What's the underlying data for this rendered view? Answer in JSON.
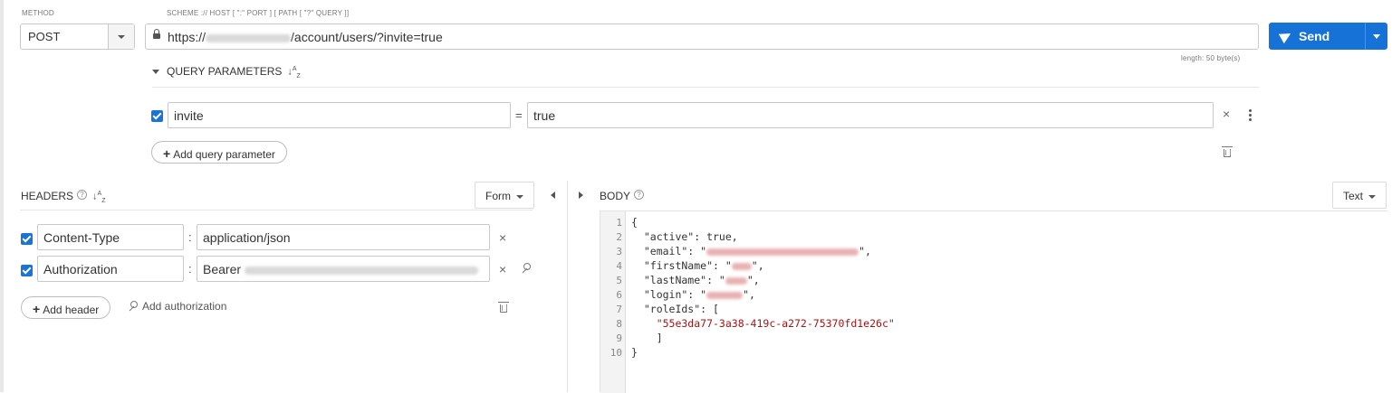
{
  "request": {
    "method_label": "METHOD",
    "method": "POST",
    "url_hint": "SCHEME :// HOST [ \":\" PORT ] [ PATH [ \"?\" QUERY ]]",
    "url_prefix": "https://",
    "url_suffix": "/account/users/?invite=true",
    "length_text": "length: 50 byte(s)",
    "send_label": "Send"
  },
  "query": {
    "title": "QUERY PARAMETERS",
    "params": [
      {
        "name": "invite",
        "value": "true",
        "enabled": true
      }
    ],
    "add_label": "Add query parameter"
  },
  "headers": {
    "title": "HEADERS",
    "mode": "Form",
    "items": [
      {
        "name": "Content-Type",
        "value": "application/json",
        "enabled": true
      },
      {
        "name": "Authorization",
        "value": "Bearer ",
        "enabled": true
      }
    ],
    "add_label": "Add header",
    "auth_label": "Add authorization"
  },
  "body": {
    "title": "BODY",
    "mode": "Text",
    "line_numbers": [
      "1",
      "2",
      "3",
      "4",
      "5",
      "6",
      "7",
      "8",
      "9",
      "10"
    ],
    "lines": [
      "{",
      "  \"active\": true,",
      "  \"email\": \"",
      "  \"firstName\": \"",
      "  \"lastName\": \"",
      "  \"login\": \"",
      "  \"roleIds\": [",
      "    \"55e3da77-3a38-419c-a272-75370fd1e26c\"",
      "    ]",
      "}"
    ]
  },
  "colors": {
    "accent": "#1672d6",
    "checkbox": "#1a73d8",
    "json_key": "#8b0000",
    "json_string": "#a31515",
    "json_bool": "#0000aa"
  },
  "icons": {
    "lock": "lock-icon",
    "send": "paper-plane-icon",
    "sort": "sort-az-icon",
    "delete": "trash-icon",
    "remove": "close-icon",
    "more": "vertical-dots-icon",
    "auth": "key-icon",
    "help": "help-circle-icon"
  }
}
